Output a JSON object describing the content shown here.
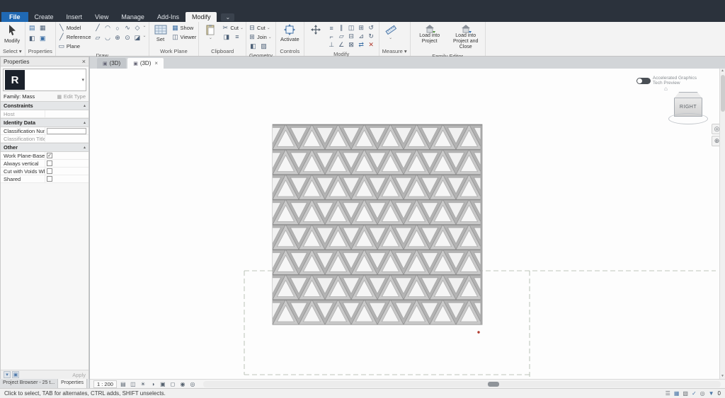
{
  "tabs": {
    "items": [
      "File",
      "Create",
      "Insert",
      "View",
      "Manage",
      "Add-Ins",
      "Modify"
    ]
  },
  "ribbon": {
    "select": {
      "button": "Modify",
      "label": "Select ▾"
    },
    "properties": {
      "label": "Properties"
    },
    "draw": {
      "label": "Draw",
      "model": "Model",
      "reference": "Reference",
      "plane": "Plane"
    },
    "work_plane": {
      "label": "Work Plane",
      "set": "Set",
      "show": "Show",
      "viewer": "Viewer"
    },
    "clipboard": {
      "label": "Clipboard",
      "cut": "Cut"
    },
    "geometry": {
      "label": "Geometry",
      "cut": "Cut",
      "join": "Join"
    },
    "controls": {
      "label": "Controls",
      "activate": "Activate"
    },
    "modify": {
      "label": "Modify"
    },
    "measure": {
      "label": "Measure ▾"
    },
    "family_editor": {
      "label": "Family Editor",
      "load": "Load into Project",
      "load_close": "Load into Project and Close"
    }
  },
  "properties_palette": {
    "title": "Properties",
    "thumbnail_letter": "R",
    "family": "Family: Mass",
    "edit_type": "Edit Type",
    "groups": {
      "constraints": "Constraints",
      "identity": "Identity Data",
      "other": "Other"
    },
    "rows": {
      "host": "Host",
      "classification_number": "Classification Number",
      "classification_title": "Classification Title",
      "work_plane_based": "Work Plane-Based",
      "always_vertical": "Always vertical",
      "cut_with_voids": "Cut with Voids When ...",
      "shared": "Shared",
      "check": "✓"
    },
    "apply": "Apply",
    "bottom_tabs": [
      "Project Browser - 25 t...",
      "Properties"
    ]
  },
  "view_tabs": [
    "(3D)",
    "(3D)"
  ],
  "canvas": {
    "viewcube_face": "RIGHT",
    "accel_line1": "Accelerated Graphics",
    "accel_line2": "Tech Preview"
  },
  "view_controls": {
    "scale": "1 : 200"
  },
  "status_bar": {
    "hint": "Click to select, TAB for alternates, CTRL adds, SHIFT unselects.",
    "selection_count": "0"
  }
}
